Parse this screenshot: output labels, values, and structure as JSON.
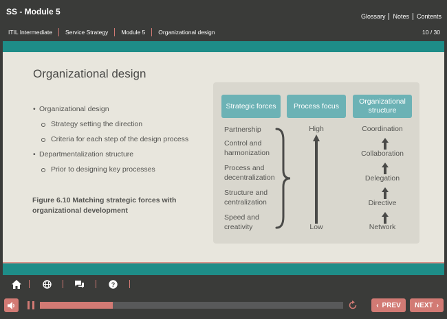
{
  "header": {
    "course_title": "SS - Module 5",
    "links": [
      "Glossary",
      "Notes",
      "Contents"
    ],
    "breadcrumb": [
      "ITIL Intermediate",
      "Service Strategy",
      "Module 5",
      "Organizational design"
    ],
    "page_counter": "10 / 30"
  },
  "slide": {
    "title": "Organizational design",
    "bullets": [
      {
        "level": 1,
        "text": "Organizational design"
      },
      {
        "level": 2,
        "text": "Strategy setting the direction"
      },
      {
        "level": 2,
        "text": "Criteria for each step of the design process"
      },
      {
        "level": 1,
        "text": "Departmentalization structure"
      },
      {
        "level": 2,
        "text": "Prior to designing key processes"
      }
    ],
    "figure_caption": "Figure 6.10  Matching strategic forces with organizational development",
    "diagram": {
      "headers": {
        "strategic_forces": "Strategic forces",
        "process_focus": "Process focus",
        "organizational_structure": "Organizational structure"
      },
      "forces": [
        "Partnership",
        "Control and harmonization",
        "Process and decentralization",
        "Structure and centralization",
        "Speed and creativity"
      ],
      "process_focus": {
        "high": "High",
        "low": "Low"
      },
      "structures": [
        "Coordination",
        "Collaboration",
        "Delegation",
        "Directive",
        "Network"
      ]
    }
  },
  "toolbar": {
    "icons": [
      "home-icon",
      "globe-icon",
      "chat-icon",
      "help-icon"
    ]
  },
  "player": {
    "progress_fraction": 0.24,
    "prev_label": "PREV",
    "next_label": "NEXT"
  },
  "colors": {
    "accent": "#d27a74",
    "teal": "#1e8d88",
    "header_box": "#6cb2b5",
    "background": "#3a3b39",
    "slide_bg": "#e8e6dd"
  }
}
